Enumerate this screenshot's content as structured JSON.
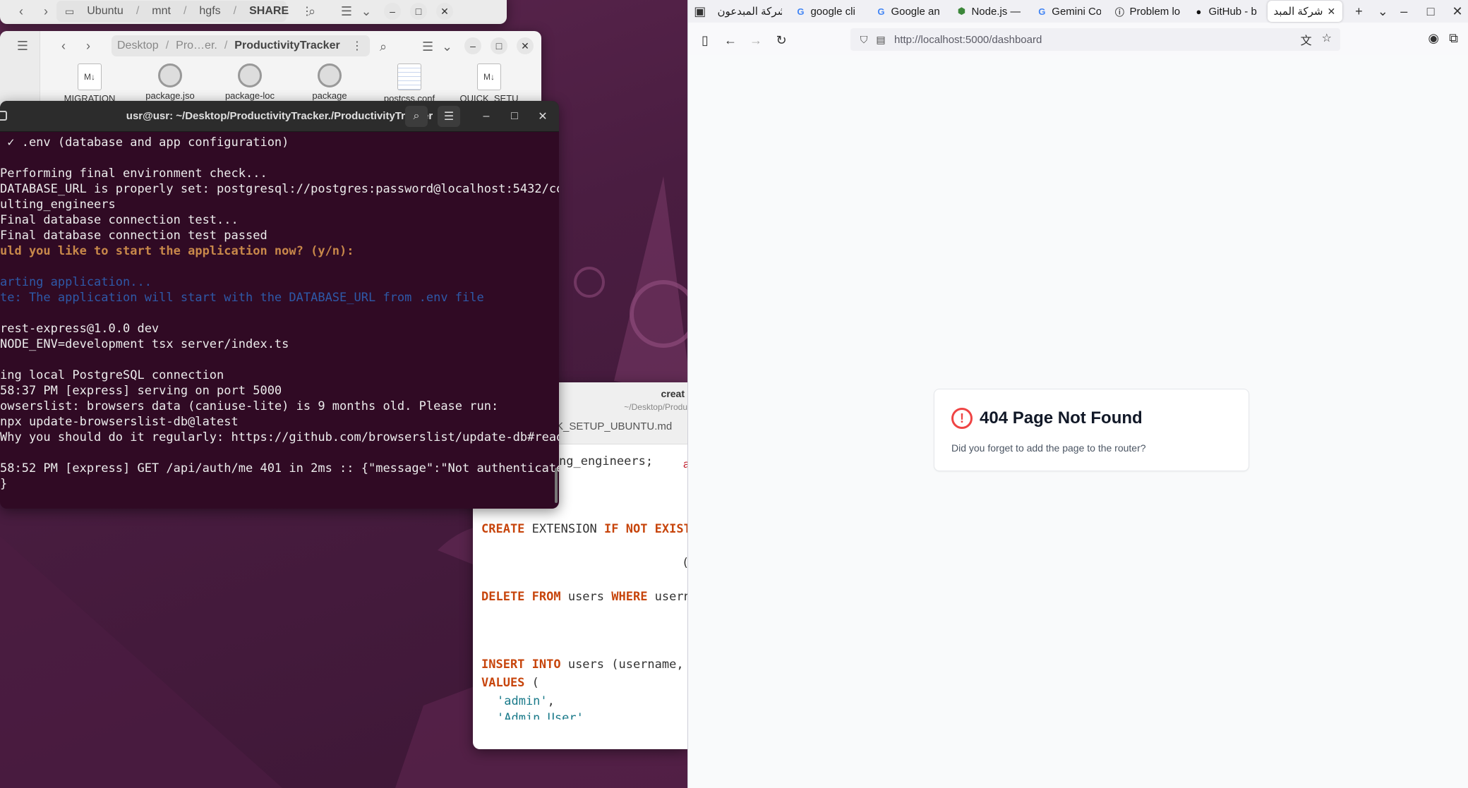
{
  "desktop": {
    "fm_back": {
      "path": [
        "Ubuntu",
        "mnt",
        "hgfs",
        "SHARE"
      ]
    },
    "fm_front": {
      "path": [
        "Desktop",
        "Pro…er.",
        "ProductivityTracker"
      ],
      "files": [
        {
          "name": "MIGRATION",
          "icon": "markdown-icon"
        },
        {
          "name": "package.jso",
          "icon": "gear-icon"
        },
        {
          "name": "package-loc",
          "icon": "gear-icon"
        },
        {
          "name": "package",
          "icon": "gear-icon"
        },
        {
          "name": "postcss.conf",
          "icon": "document-icon"
        },
        {
          "name": "QUICK_SETU",
          "icon": "markdown-icon"
        }
      ]
    },
    "editor": {
      "title": "creat",
      "subtitle": "~/Desktop/Produ",
      "tab": "K_SETUP_UBUNTU.md",
      "accent_char": "a",
      "paren": "(",
      "code": {
        "line1": "ng_engineers;",
        "create_kw1": "CREATE",
        "create_mid": " EXTENSION ",
        "create_kw2": "IF NOT EXIST",
        "delete_kw1": "DELETE FROM",
        "delete_mid": " users ",
        "delete_kw2": "WHERE",
        "delete_end": " usern",
        "insert_kw": "INSERT INTO",
        "insert_end": " users (username,",
        "values_kw": "VALUES",
        "values_end": " (",
        "admin_str": "'admin'",
        "admin_comma": ",",
        "admin_user_str": "'Admin User'"
      }
    },
    "terminal": {
      "title": "usr@usr: ~/Desktop/ProductivityTracker./ProductivityTracker",
      "lines": [
        {
          "text": " ✓ .env (database and app configuration)",
          "kind": "normal"
        },
        {
          "text": "",
          "kind": "normal"
        },
        {
          "text": "Performing final environment check...",
          "kind": "normal"
        },
        {
          "text": "DATABASE_URL is properly set: postgresql://postgres:password@localhost:5432/co",
          "kind": "normal"
        },
        {
          "text": "ulting_engineers",
          "kind": "normal"
        },
        {
          "text": "Final database connection test...",
          "kind": "normal"
        },
        {
          "text": "Final database connection test passed",
          "kind": "normal"
        },
        {
          "text": "uld you like to start the application now? (y/n):",
          "kind": "prompt"
        },
        {
          "text": "",
          "kind": "normal"
        },
        {
          "text": "arting application...",
          "kind": "info"
        },
        {
          "text": "te: The application will start with the DATABASE_URL from .env file",
          "kind": "info"
        },
        {
          "text": "",
          "kind": "normal"
        },
        {
          "text": "rest-express@1.0.0 dev",
          "kind": "normal"
        },
        {
          "text": "NODE_ENV=development tsx server/index.ts",
          "kind": "normal"
        },
        {
          "text": "",
          "kind": "normal"
        },
        {
          "text": "ing local PostgreSQL connection",
          "kind": "normal"
        },
        {
          "text": "58:37 PM [express] serving on port 5000",
          "kind": "normal"
        },
        {
          "text": "owserslist: browsers data (caniuse-lite) is 9 months old. Please run:",
          "kind": "normal"
        },
        {
          "text": "npx update-browserslist-db@latest",
          "kind": "normal"
        },
        {
          "text": "Why you should do it regularly: https://github.com/browserslist/update-db#read",
          "kind": "normal"
        },
        {
          "text": "",
          "kind": "normal"
        },
        {
          "text": "58:52 PM [express] GET /api/auth/me 401 in 2ms :: {\"message\":\"Not authenticate",
          "kind": "normal"
        },
        {
          "text": "}",
          "kind": "normal"
        }
      ]
    }
  },
  "browser": {
    "tabs": [
      {
        "label": "شركة المبدعون",
        "favicon": "site-icon",
        "fav_glyph": ""
      },
      {
        "label": "google cli",
        "favicon": "google-icon",
        "fav_glyph": "G"
      },
      {
        "label": "Google an",
        "favicon": "google-icon",
        "fav_glyph": "G"
      },
      {
        "label": "Node.js —",
        "favicon": "nodejs-icon",
        "fav_glyph": "⬢"
      },
      {
        "label": "Gemini Co",
        "favicon": "google-icon",
        "fav_glyph": "G"
      },
      {
        "label": "Problem lo",
        "favicon": "info-icon",
        "fav_glyph": "ⓘ"
      },
      {
        "label": "GitHub - b",
        "favicon": "github-icon",
        "fav_glyph": "●"
      },
      {
        "label": "شركة المبد",
        "favicon": "site-icon",
        "fav_glyph": "",
        "active": true
      }
    ],
    "url": "http://localhost:5000/dashboard",
    "page": {
      "title": "404 Page Not Found",
      "message": "Did you forget to add the page to the router?",
      "icon": "!"
    },
    "colors": {
      "error": "#ef4444",
      "terminal_bg": "#300a24",
      "desktop_bg": "#5e2750"
    }
  }
}
